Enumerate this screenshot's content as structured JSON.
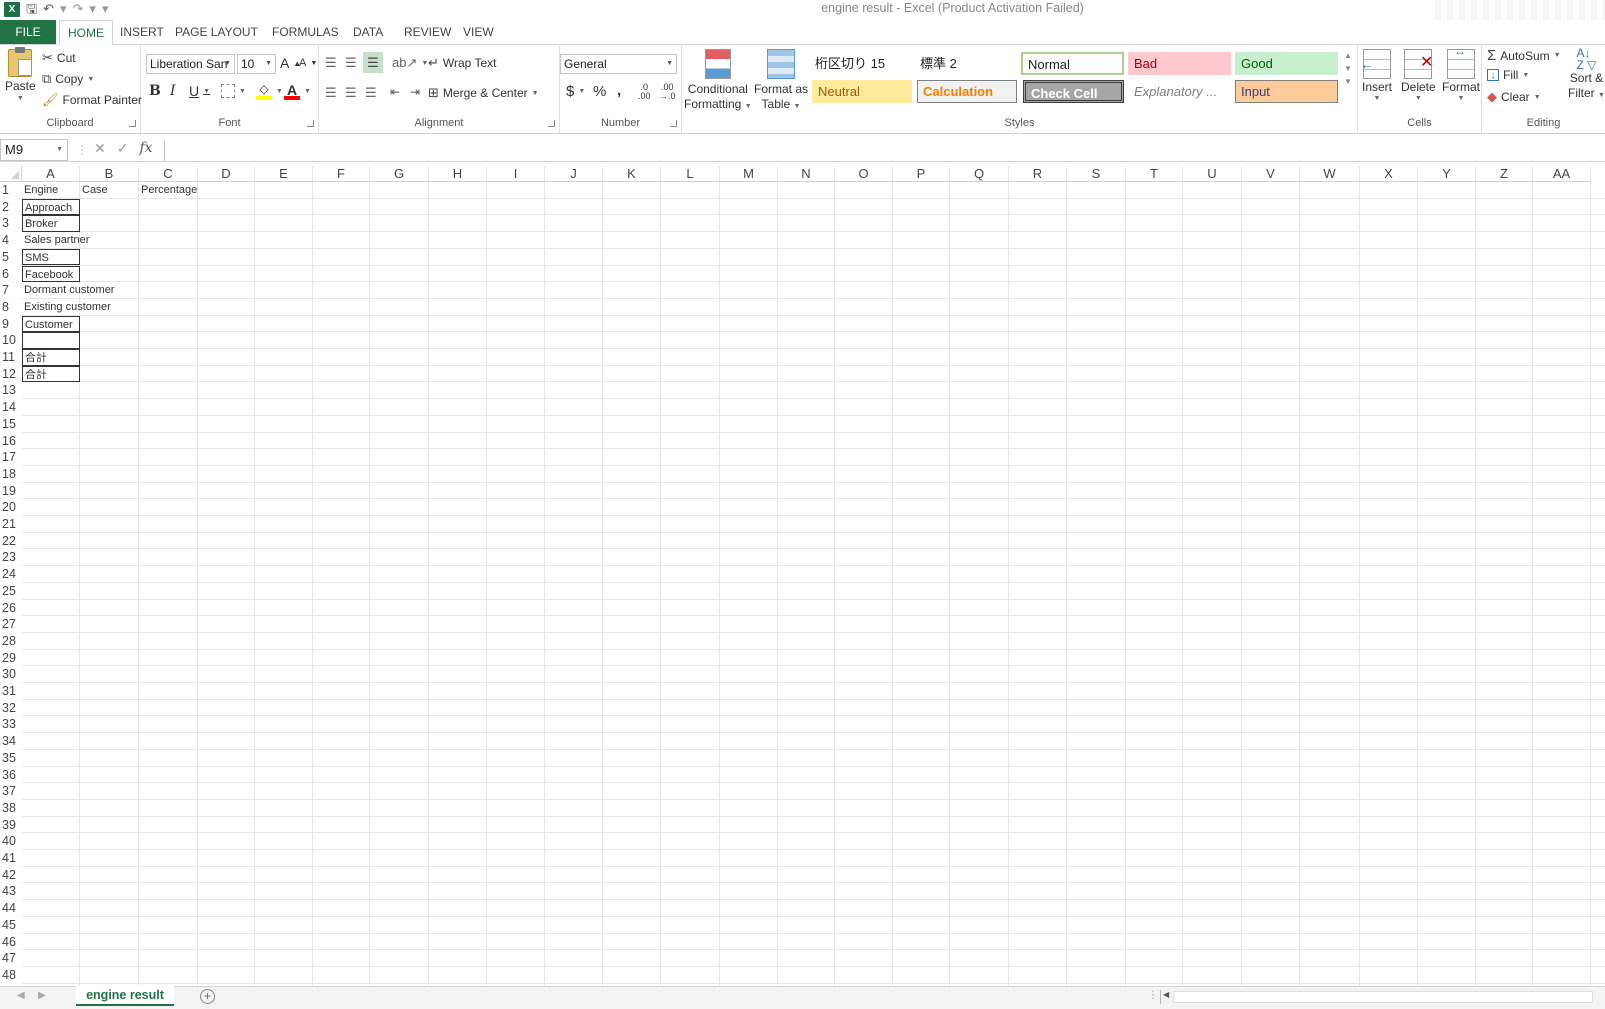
{
  "title": "engine result - Excel (Product Activation Failed)",
  "qat": {
    "logo": "X",
    "save": "🖫",
    "undo": "↶",
    "redo": "↷",
    "more": "▾"
  },
  "tabs": [
    "FILE",
    "HOME",
    "INSERT",
    "PAGE LAYOUT",
    "FORMULAS",
    "DATA",
    "REVIEW",
    "VIEW"
  ],
  "clipboard": {
    "label": "Clipboard",
    "paste": "Paste",
    "cut": "Cut",
    "copy": "Copy",
    "format_painter": "Format Painter"
  },
  "font": {
    "label": "Font",
    "name": "Liberation Sans",
    "size": "10",
    "grow": "A",
    "shrink": "A",
    "bold": "B",
    "italic": "I",
    "underline": "U",
    "font_color": "A"
  },
  "alignment": {
    "label": "Alignment",
    "wrap_text": "Wrap Text",
    "merge_center": "Merge & Center"
  },
  "number": {
    "label": "Number",
    "format": "General",
    "currency": "$",
    "percent": "%",
    "comma": ",",
    "inc_dec": ".00",
    "dec_dec": ".0"
  },
  "styles": {
    "label": "Styles",
    "conditional": "Conditional",
    "conditional2": "Formatting",
    "format_table": "Format as",
    "format_table2": "Table",
    "cells": [
      {
        "name": "桁区切り 15"
      },
      {
        "name": "標準 2"
      },
      {
        "name": "Normal"
      },
      {
        "name": "Bad"
      },
      {
        "name": "Good"
      },
      {
        "name": "Neutral"
      },
      {
        "name": "Calculation"
      },
      {
        "name": "Check Cell"
      },
      {
        "name": "Explanatory ..."
      },
      {
        "name": "Input"
      }
    ]
  },
  "cells_group": {
    "label": "Cells",
    "insert": "Insert",
    "delete": "Delete",
    "format": "Format"
  },
  "editing": {
    "label": "Editing",
    "autosum": "AutoSum",
    "fill": "Fill",
    "clear": "Clear",
    "sort": "Sort &",
    "filter": "Filter"
  },
  "formula_bar": {
    "name_box": "M9",
    "fx": "fx",
    "cancel": "✕",
    "enter": "✓",
    "value": ""
  },
  "columns": [
    "A",
    "B",
    "C",
    "D",
    "E",
    "F",
    "G",
    "H",
    "I",
    "J",
    "K",
    "L",
    "M",
    "N",
    "O",
    "P",
    "Q",
    "R",
    "S",
    "T",
    "U",
    "V",
    "W",
    "X",
    "Y",
    "Z",
    "AA"
  ],
  "row_count": 48,
  "sheet": {
    "A1": "Engine",
    "B1": "Case",
    "C1": "Percentage",
    "A2": "Approach",
    "A3": "Broker",
    "A4": "Sales partner",
    "A5": "SMS",
    "A6": "Facebook",
    "A7": "Dormant customer",
    "A8": "Existing customer",
    "A9": "Customer",
    "A10": "",
    "A11": "合計",
    "A12": "合計"
  },
  "sheet_tab": "engine result",
  "add_sheet": "+",
  "colors": {
    "accent": "#217346",
    "neutral": "#ffeb9c",
    "bad": "#ffc7ce",
    "good": "#c6efce",
    "input": "#ffcc99",
    "check": "#a5a5a5",
    "calc": "#f2f2f2"
  }
}
